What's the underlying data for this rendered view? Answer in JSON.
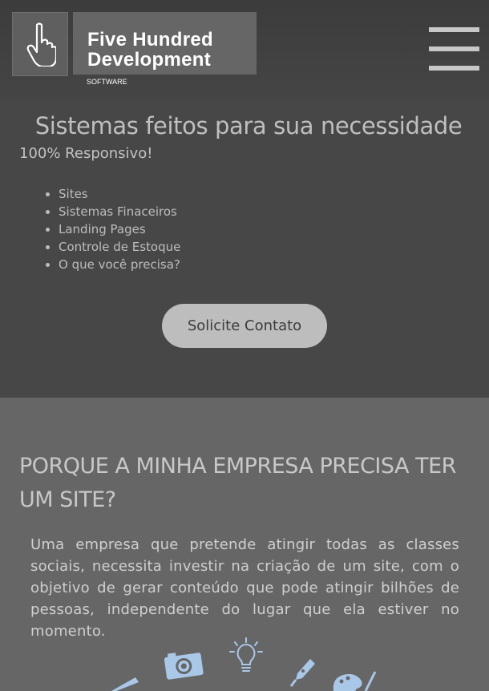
{
  "header": {
    "logo_line1": "Five Hundred",
    "logo_line2": "Development",
    "logo_sub": "SOFTWARE",
    "logo_icon": "pointing-hand-icon",
    "menu_icon": "hamburger-menu-icon"
  },
  "hero": {
    "title": "Sistemas feitos para sua necessidade",
    "subtitle": "100% Responsivo!",
    "items": [
      "Sites",
      "Sistemas Finaceiros",
      "Landing Pages",
      "Controle de Estoque",
      "O que você precisa?"
    ],
    "cta_label": "Solicite Contato"
  },
  "why": {
    "title": "PORQUE A MINHA EMPRESA PRECISA TER UM SITE?",
    "text": "Uma empresa que pretende atingir todas as classes sociais, necessita investir na criação de um site, com o objetivo de gerar conteúdo que pode atingir bilhões de pessoas, independente do lugar que ela estiver no momento.",
    "icons": [
      "pencil-icon",
      "camera-icon",
      "lightbulb-icon",
      "pen-nib-icon",
      "paint-palette-icon"
    ]
  },
  "colors": {
    "header_bg": "#3c3c3c",
    "hero_bg": "#474747",
    "section_bg": "#666666",
    "button_bg": "#bdbdbd",
    "icon_blue": "#a9c8e8"
  }
}
